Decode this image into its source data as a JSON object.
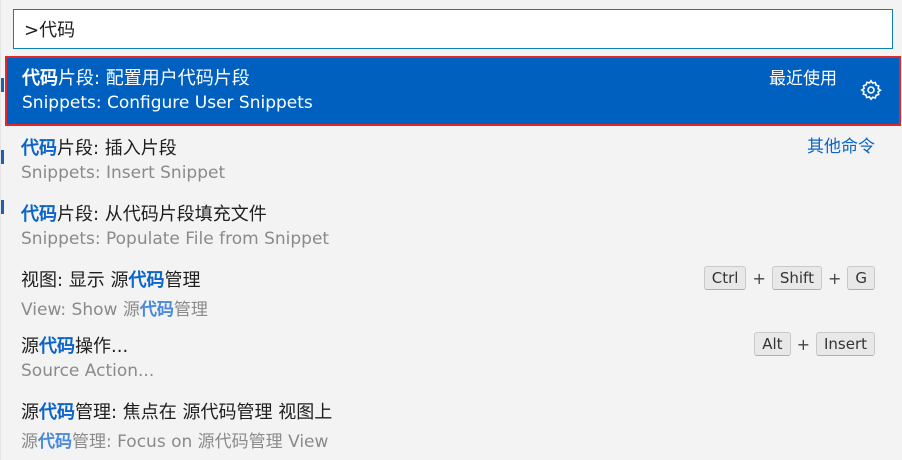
{
  "search": {
    "value": ">代码",
    "placeholder": ""
  },
  "colors": {
    "accent": "#0060c0",
    "focus_border": "#e3262b",
    "highlight": "#0b64c8"
  },
  "items": [
    {
      "label_hl": "代码",
      "label_rest": "片段: 配置用户代码片段",
      "detail": "Snippets: Configure User Snippets",
      "right": "最近使用",
      "icon": "gear-icon"
    },
    {
      "label_hl": "代码",
      "label_rest": "片段: 插入片段",
      "detail": "Snippets: Insert Snippet",
      "right": "其他命令"
    },
    {
      "label_hl": "代码",
      "label_rest": "片段: 从代码片段填充文件",
      "detail": "Snippets: Populate File from Snippet"
    },
    {
      "label_pre": "视图: 显示 源",
      "label_hl": "代码",
      "label_rest": "管理",
      "detail_pre": "View: Show 源",
      "detail_hl": "代码",
      "detail_rest": "管理",
      "keys": [
        "Ctrl",
        "Shift",
        "G"
      ],
      "plus": "+"
    },
    {
      "label_pre": "源",
      "label_hl": "代码",
      "label_rest": "操作...",
      "detail": "Source Action...",
      "keys": [
        "Alt",
        "Insert"
      ],
      "plus": "+"
    },
    {
      "label_pre": "源",
      "label_hl": "代码",
      "label_rest": "管理: 焦点在 源代码管理 视图上",
      "detail_pre": "源",
      "detail_hl": "代码",
      "detail_rest": "管理: Focus on 源代码管理 View"
    }
  ]
}
